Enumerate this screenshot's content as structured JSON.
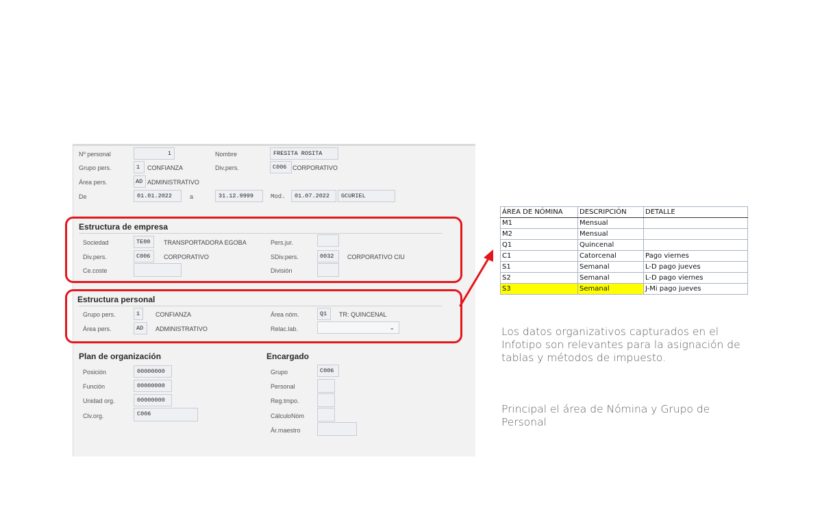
{
  "header": {
    "personal_label": "Nº personal",
    "personal_value": "1",
    "nombre_label": "Nombre",
    "nombre_value": "FRESITA ROSITA",
    "grupo_label": "Grupo pers.",
    "grupo_code": "1",
    "grupo_text": "CONFIANZA",
    "divpers_label": "Div.pers.",
    "divpers_code": "C006",
    "divpers_text": "CORPORATIVO",
    "area_label": "Área pers.",
    "area_code": "AD",
    "area_text": "ADMINISTRATIVO",
    "de_label": "De",
    "de_value": "01.01.2022",
    "a_label": "a",
    "a_value": "31.12.9999",
    "mod_label": "Mod.",
    "mod_date": "01.07.2022",
    "mod_user": "GCURIEL"
  },
  "empresa": {
    "title": "Estructura de empresa",
    "sociedad_label": "Sociedad",
    "sociedad_code": "TE00",
    "sociedad_text": "TRANSPORTADORA EGOBA",
    "persjur_label": "Pers.jur.",
    "persjur_value": "",
    "divpers_label": "Div.pers.",
    "divpers_code": "C006",
    "divpers_text": "CORPORATIVO",
    "sdiv_label": "SDiv.pers.",
    "sdiv_code": "0032",
    "sdiv_text": "CORPORATIVO CIU",
    "cecoste_label": "Ce.coste",
    "cecoste_value": "",
    "division_label": "División",
    "division_value": ""
  },
  "personal": {
    "title": "Estructura personal",
    "grupo_label": "Grupo pers.",
    "grupo_code": "1",
    "grupo_text": "CONFIANZA",
    "areanom_label": "Área nóm.",
    "areanom_code": "Q1",
    "areanom_text": "TR: QUINCENAL",
    "area_label": "Área pers.",
    "area_code": "AD",
    "area_text": "ADMINISTRATIVO",
    "relac_label": "Relac.lab.",
    "relac_value": ""
  },
  "organizacion": {
    "title": "Plan de organización",
    "posicion_label": "Posición",
    "posicion_value": "00000000",
    "funcion_label": "Función",
    "funcion_value": "00000000",
    "unidad_label": "Unidad org.",
    "unidad_value": "00000000",
    "clv_label": "Clv.org.",
    "clv_value": "C006"
  },
  "encargado": {
    "title": "Encargado",
    "grupo_label": "Grupo",
    "grupo_value": "C006",
    "personal_label": "Personal",
    "personal_value": "",
    "regtmpo_label": "Reg.tmpo.",
    "regtmpo_value": "",
    "calculo_label": "CálculoNóm",
    "calculo_value": "",
    "armaestro_label": "Ár.maestro",
    "armaestro_value": ""
  },
  "nomina_table": {
    "headers": [
      "ÁREA DE NÓMINA",
      "DESCRIPCIÓN",
      "DETALLE"
    ],
    "rows": [
      [
        "M1",
        "Mensual",
        ""
      ],
      [
        "M2",
        "Mensual",
        ""
      ],
      [
        "Q1",
        "Quincenal",
        ""
      ],
      [
        "C1",
        "Catorcenal",
        "Pago viernes"
      ],
      [
        "S1",
        "Semanal",
        "L-D pago jueves"
      ],
      [
        "S2",
        "Semanal",
        "L-D pago viernes"
      ],
      [
        "S3",
        "Semanal",
        "J-Mi pago jueves"
      ]
    ],
    "highlight_color": "#ffff00"
  },
  "notes": {
    "paragraph1": "Los datos organizativos capturados en el Infotipo son relevantes para la asignación de tablas y métodos de impuesto.",
    "paragraph2": "Principal el área de Nómina y Grupo de Personal"
  },
  "colors": {
    "annotation_red": "#e3161b",
    "panel_bg": "#f2f2f2"
  },
  "icons": {
    "dropdown": "chevron-down-icon",
    "arrow": "red-arrow-icon"
  }
}
